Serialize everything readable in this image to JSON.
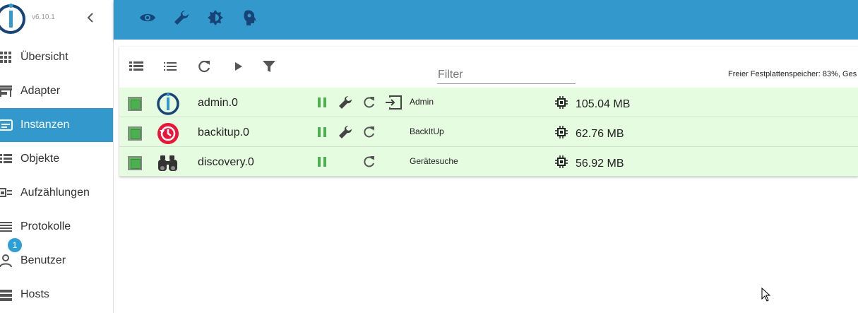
{
  "sidebar": {
    "version": "v6.10.1",
    "items": [
      {
        "label": "Übersicht",
        "icon": "grid-icon"
      },
      {
        "label": "Adapter",
        "icon": "store-icon"
      },
      {
        "label": "Instanzen",
        "icon": "instances-icon",
        "active": true
      },
      {
        "label": "Objekte",
        "icon": "list-icon"
      },
      {
        "label": "Aufzählungen",
        "icon": "enum-icon"
      },
      {
        "label": "Protokolle",
        "icon": "logs-icon"
      },
      {
        "label": "Benutzer",
        "icon": "user-icon"
      },
      {
        "label": "Hosts",
        "icon": "hosts-icon",
        "badge": "1"
      }
    ]
  },
  "topbar": {
    "icons": [
      "eye-icon",
      "wrench-icon",
      "brightness-icon",
      "expert-mode-icon"
    ]
  },
  "toolbar": {
    "icons": [
      "view-rows-icon",
      "view-list-icon",
      "refresh-icon",
      "play-icon",
      "filter-icon"
    ],
    "filter_placeholder": "Filter",
    "disk_info": "Freier Festplattenspeicher: 83%, Ges"
  },
  "instances": [
    {
      "name": "admin.0",
      "title": "Admin",
      "memory": "105.04 MB",
      "icon": "iobroker-logo-icon",
      "has_settings": true,
      "has_link": true
    },
    {
      "name": "backitup.0",
      "title": "BackItUp",
      "memory": "62.76 MB",
      "icon": "backitup-icon",
      "has_settings": true,
      "has_link": false
    },
    {
      "name": "discovery.0",
      "title": "Gerätesuche",
      "memory": "56.92 MB",
      "icon": "binoculars-icon",
      "has_settings": false,
      "has_link": false
    }
  ],
  "colors": {
    "primary": "#3399cc",
    "row_running": "#e6fce0",
    "pause_green": "#4caf50"
  }
}
